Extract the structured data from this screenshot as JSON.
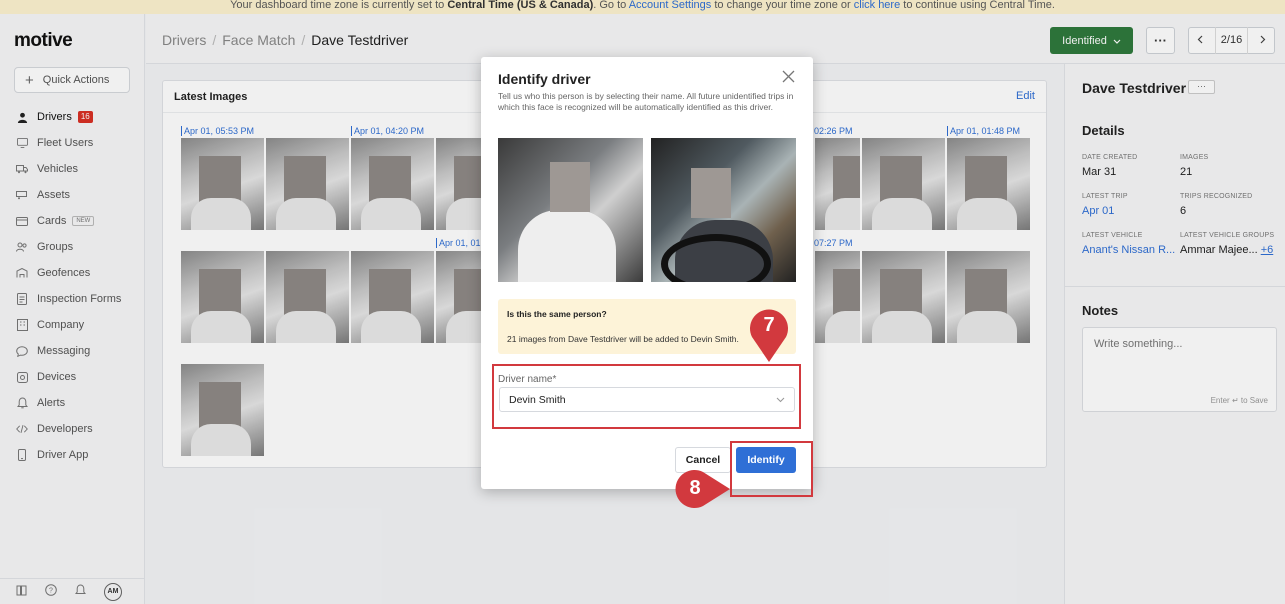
{
  "banner": {
    "text_a": "Your dashboard time zone is currently set to ",
    "zone": "Central Time (US & Canada)",
    "text_b": ". Go to ",
    "link_settings": "Account Settings",
    "text_c": " to change your time zone or ",
    "link_here": "click here",
    "text_d": " to continue using Central Time."
  },
  "app": {
    "logo": "motive"
  },
  "sidebar": {
    "quick_actions": "Quick Actions",
    "items": [
      {
        "label": "Drivers",
        "badge": "16",
        "icon": "person-icon"
      },
      {
        "label": "Fleet Users",
        "icon": "monitor-icon"
      },
      {
        "label": "Vehicles",
        "icon": "truck-icon"
      },
      {
        "label": "Assets",
        "icon": "trailer-icon"
      },
      {
        "label": "Cards",
        "tag": "NEW",
        "icon": "card-icon"
      },
      {
        "label": "Groups",
        "icon": "groups-icon"
      },
      {
        "label": "Geofences",
        "icon": "geofence-icon"
      },
      {
        "label": "Inspection Forms",
        "icon": "form-icon"
      },
      {
        "label": "Company",
        "icon": "building-icon"
      },
      {
        "label": "Messaging",
        "icon": "chat-icon"
      },
      {
        "label": "Devices",
        "icon": "device-icon"
      },
      {
        "label": "Alerts",
        "icon": "bell-icon"
      },
      {
        "label": "Developers",
        "icon": "code-icon"
      },
      {
        "label": "Driver App",
        "icon": "phone-icon"
      }
    ],
    "footer": {
      "avatar": "AM"
    }
  },
  "header": {
    "breadcrumb": [
      "Drivers",
      "Face Match",
      "Dave Testdriver"
    ],
    "status_button": "Identified",
    "pager": {
      "current": "2",
      "total": "16"
    }
  },
  "images_card": {
    "title": "Latest Images",
    "edit": "Edit",
    "timestamps_row1": [
      "Apr 01, 05:53 PM",
      "Apr 01, 04:20 PM",
      "02:26 PM",
      "Apr 01, 01:48 PM"
    ],
    "timestamps_row2": [
      "Apr 01, 01",
      "07:27 PM"
    ]
  },
  "details": {
    "name": "Dave Testdriver",
    "section_title": "Details",
    "date_created_label": "DATE CREATED",
    "date_created": "Mar 31",
    "images_label": "IMAGES",
    "images": "21",
    "latest_trip_label": "LATEST TRIP",
    "latest_trip": "Apr 01",
    "trips_recognized_label": "TRIPS RECOGNIZED",
    "trips_recognized": "6",
    "latest_vehicle_label": "LATEST VEHICLE",
    "latest_vehicle": "Anant's Nissan R...",
    "latest_groups_label": "LATEST VEHICLE GROUPS",
    "latest_groups": "Ammar Majee...",
    "latest_groups_more": "+6",
    "notes_title": "Notes",
    "notes_placeholder": "Write something...",
    "notes_hint": "Enter ↵ to Save"
  },
  "modal": {
    "title": "Identify driver",
    "description": "Tell us who this person is by selecting their name. All future unidentified trips in which this face is recognized will be automatically identified as this driver.",
    "question": "Is this the same person?",
    "message": "21 images from Dave Testdriver will be added to Devin Smith.",
    "driver_label": "Driver name*",
    "driver_value": "Devin Smith",
    "cancel": "Cancel",
    "identify": "Identify"
  },
  "annotations": {
    "step7": "7",
    "step8": "8",
    "color": "#d2393e"
  }
}
